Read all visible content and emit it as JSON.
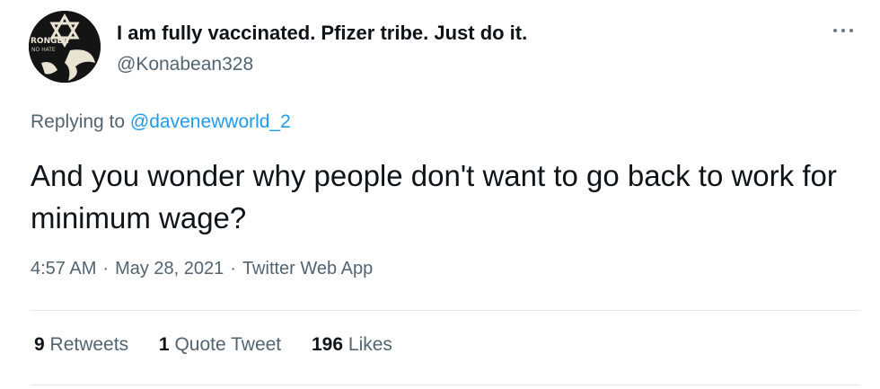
{
  "author": {
    "display_name": "I am fully vaccinated. Pfizer tribe. Just do it.",
    "handle": "@Konabean328",
    "avatar_text": "RONGER",
    "avatar_subtext": "NO HATE"
  },
  "reply": {
    "prefix": "Replying to",
    "mention": "@davenewworld_2"
  },
  "tweet": {
    "text": "And you wonder why people don't want to go back to work for minimum wage?"
  },
  "meta": {
    "time": "4:57 AM",
    "date": "May 28, 2021",
    "source": "Twitter Web App",
    "separator": "·"
  },
  "stats": {
    "retweets_count": "9",
    "retweets_label": "Retweets",
    "quotes_count": "1",
    "quotes_label": "Quote Tweet",
    "likes_count": "196",
    "likes_label": "Likes"
  },
  "icons": {
    "more": "more-options-icon",
    "avatar": "star-of-david-emblem"
  },
  "colors": {
    "text": "#0f1419",
    "secondary": "#536471",
    "link": "#1d9bf0",
    "divider": "#e3e7ea"
  }
}
